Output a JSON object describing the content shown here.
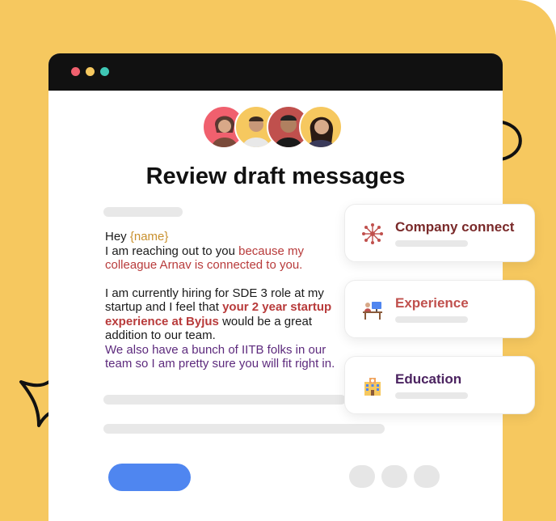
{
  "window": {
    "title": "Review draft messages",
    "traffic_lights": [
      "#f0606e",
      "#f6c85f",
      "#3fc7b5"
    ]
  },
  "message": {
    "greeting": "Hey ",
    "placeholder": "{name}",
    "line1_plain": "I am reaching out to you ",
    "line1_highlight": "because my colleague Arnav is connected to you.",
    "para2_plain": "I am currently hiring for SDE 3 role at my startup and I feel that ",
    "para2_highlight": "your 2 year startup experience at Byjus",
    "para2_tail": " would be a great addition to our team.",
    "para3": "We also have a bunch of IITB folks in our team so I am pretty sure you will fit right in."
  },
  "cards": [
    {
      "label": "Company connect",
      "icon": "network-icon",
      "color": "#7a2a2a"
    },
    {
      "label": "Experience",
      "icon": "person-at-desk-icon",
      "color": "#c0504d"
    },
    {
      "label": "Education",
      "icon": "school-building-icon",
      "color": "#4b2360"
    }
  ],
  "colors": {
    "background": "#f6c85f",
    "primary_button": "#4f86f0",
    "highlight_red": "#b83b3b",
    "highlight_purple": "#5d2a7d",
    "placeholder": "#c8902e"
  }
}
